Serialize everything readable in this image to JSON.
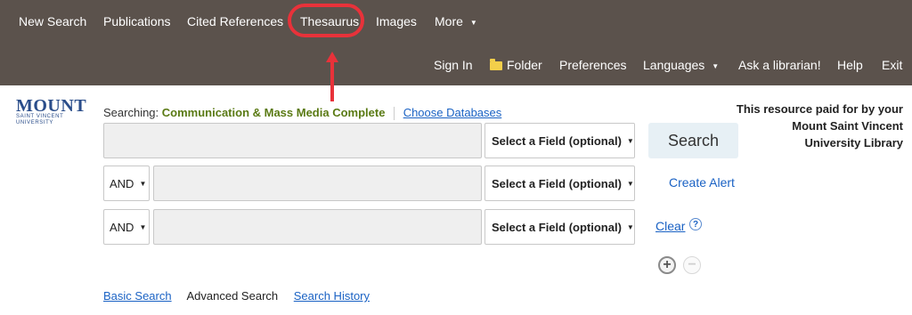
{
  "top_nav": {
    "items": [
      {
        "label": "New Search"
      },
      {
        "label": "Publications"
      },
      {
        "label": "Cited References"
      },
      {
        "label": "Thesaurus"
      },
      {
        "label": "Images"
      },
      {
        "label": "More"
      }
    ]
  },
  "user_nav": {
    "items": [
      {
        "label": "Sign In"
      },
      {
        "label": "Folder"
      },
      {
        "label": "Preferences"
      },
      {
        "label": "Languages"
      },
      {
        "label": "Ask a librarian!"
      },
      {
        "label": "Help"
      },
      {
        "label": "Exit"
      }
    ]
  },
  "logo": {
    "line1": "MOUNT",
    "line2": "Saint Vincent",
    "line3": "University"
  },
  "searching": {
    "prefix": "Searching:",
    "database": "Communication & Mass Media Complete",
    "choose_link": "Choose Databases"
  },
  "search_rows": [
    {
      "bool": "",
      "value": "",
      "field": "Select a Field (optional)"
    },
    {
      "bool": "AND",
      "value": "",
      "field": "Select a Field (optional)"
    },
    {
      "bool": "AND",
      "value": "",
      "field": "Select a Field (optional)"
    }
  ],
  "actions": {
    "search": "Search",
    "create_alert": "Create Alert",
    "clear": "Clear",
    "help": "?",
    "add_row": "+",
    "remove_row": "−"
  },
  "resource_note": "This resource paid for by your Mount Saint Vincent University Library",
  "bottom_links": {
    "basic": "Basic Search",
    "advanced": "Advanced Search",
    "history": "Search History"
  },
  "colors": {
    "accent": "#e8323a",
    "topbar": "#5b524c",
    "link": "#1a62c4",
    "database": "#5a7a14"
  }
}
